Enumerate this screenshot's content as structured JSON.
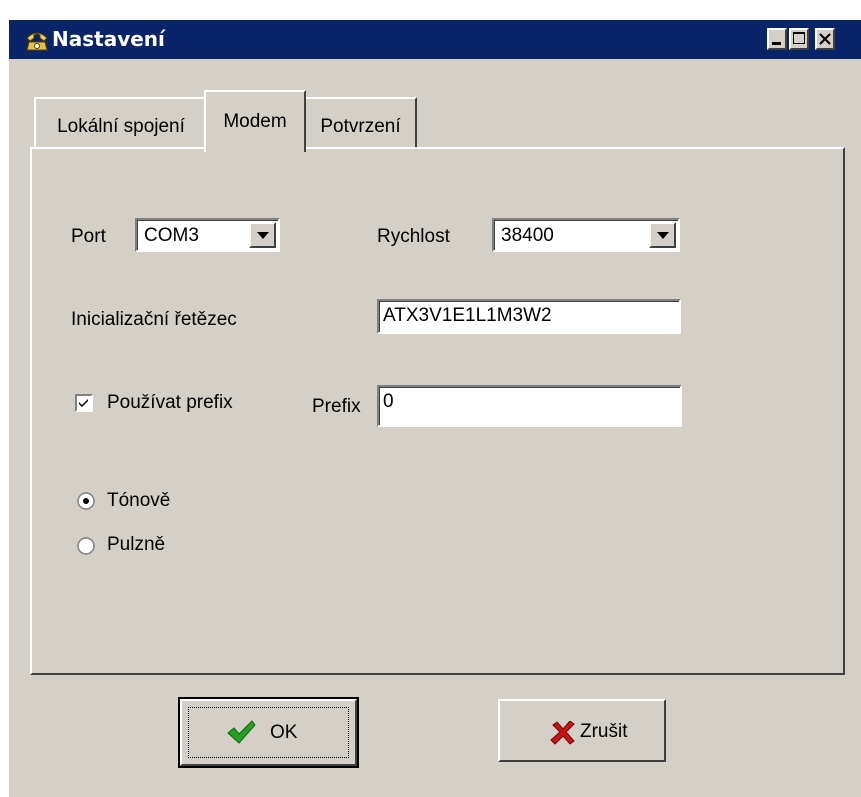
{
  "window": {
    "title": "Nastavení"
  },
  "tabs": [
    "Lokální spojení",
    "Modem",
    "Potvrzení"
  ],
  "modem": {
    "port_label": "Port",
    "port_value": "COM3",
    "speed_label": "Rychlost",
    "speed_value": "38400",
    "init_label": "Inicializační řetězec",
    "init_value": "ATX3V1E1L1M3W2",
    "use_prefix_label": "Používat prefix",
    "use_prefix_checked": true,
    "prefix_label": "Prefix",
    "prefix_value": "0",
    "dial_tone_label": "Tónově",
    "dial_pulse_label": "Pulzně",
    "dial_mode_selected": "Tónově"
  },
  "buttons": {
    "ok_label": "OK",
    "cancel_label": "Zrušit"
  },
  "colors": {
    "titlebar": "#0a246a",
    "face": "#d4d0c8",
    "ok_check": "#22a022",
    "cancel_x": "#cc1010"
  },
  "icons": {
    "title": "telephone-icon",
    "ok": "checkmark-icon",
    "cancel": "red-x-icon"
  }
}
